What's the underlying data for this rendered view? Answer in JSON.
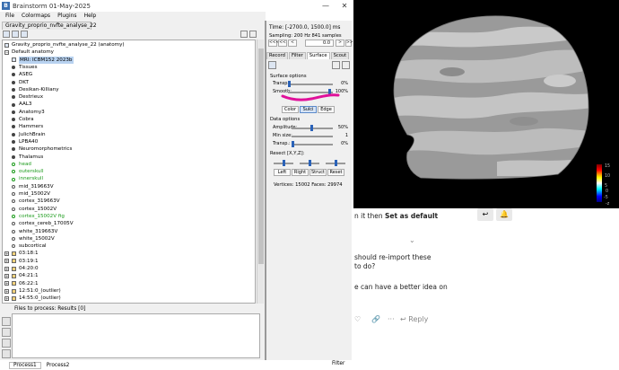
{
  "window": {
    "title": "Brainstorm 01-May-2025",
    "logo": "B",
    "minimize": "—",
    "close": "✕"
  },
  "menu": [
    "File",
    "Colormaps",
    "Plugins",
    "Help"
  ],
  "protocol_tab": "Gravity_proprio_nvfte_analyse_22",
  "tree": {
    "subject": "Gravity_proprio_nvfte_analyse_22 (anatomy)",
    "default_anatomy": "Default anatomy",
    "items": [
      {
        "label": "MRI: ICBM152 2023b",
        "kind": "mri",
        "selected": true
      },
      {
        "label": "Tissues",
        "kind": "dot"
      },
      {
        "label": "ASEG",
        "kind": "dot"
      },
      {
        "label": "DKT",
        "kind": "dot"
      },
      {
        "label": "Desikan-Killiany",
        "kind": "dot"
      },
      {
        "label": "Destrieux",
        "kind": "dot"
      },
      {
        "label": "AAL3",
        "kind": "dot"
      },
      {
        "label": "Anatomy3",
        "kind": "dot"
      },
      {
        "label": "Cobra",
        "kind": "dot"
      },
      {
        "label": "Hammers",
        "kind": "dot"
      },
      {
        "label": "JulichBrain",
        "kind": "dot"
      },
      {
        "label": "LPBA40",
        "kind": "dot"
      },
      {
        "label": "Neuromorphometrics",
        "kind": "dot"
      },
      {
        "label": "Thalamus",
        "kind": "dot"
      },
      {
        "label": "head",
        "kind": "surf",
        "green": true
      },
      {
        "label": "outerskull",
        "kind": "surf",
        "green": true
      },
      {
        "label": "innerskull",
        "kind": "surf",
        "green": true
      },
      {
        "label": "mid_319663V",
        "kind": "surf"
      },
      {
        "label": "mid_15002V",
        "kind": "surf"
      },
      {
        "label": "cortex_319663V",
        "kind": "surf"
      },
      {
        "label": "cortex_15002V",
        "kind": "surf"
      },
      {
        "label": "cortex_15002V fig",
        "kind": "surf",
        "green": true
      },
      {
        "label": "cortex_cereb_17005V",
        "kind": "surf"
      },
      {
        "label": "white_319663V",
        "kind": "surf"
      },
      {
        "label": "white_15002V",
        "kind": "surf"
      },
      {
        "label": "subcortical",
        "kind": "surf"
      }
    ],
    "folders": [
      "03:18:1",
      "03:19:1",
      "04:20:0",
      "04:21:1",
      "06:22:1",
      "12:51:0_(outlier)",
      "14:55:0_(outlier)"
    ]
  },
  "files": {
    "label": "Files to process: Results [0]"
  },
  "bottom": {
    "tabs": [
      "Process1",
      "Process2"
    ],
    "filter": "Filter"
  },
  "panel": {
    "time": "Time:  [-2700.0, 1500.0] ms",
    "sampling": "Sampling: 200 Hz    841 samples",
    "nav": [
      "<<<",
      "<<",
      "<",
      "",
      ">",
      ">>"
    ],
    "nav_value": "0.0",
    "tabs": [
      "Record",
      "Filter",
      "Surface",
      "Scout"
    ],
    "surface_options_title": "Surface options",
    "transp_label": "Transp.:",
    "transp_value": "0%",
    "smooth_label": "Smooth:",
    "smooth_value": "100%",
    "view_buttons": [
      "Color",
      "Sulci",
      "Edge"
    ],
    "data_options_title": "Data options",
    "amplitude_label": "Amplitude:",
    "amplitude_value": "50%",
    "minsize_label": "Min size:",
    "minsize_value": "1",
    "dtransp_label": "Transp.:",
    "dtransp_value": "0%",
    "resect_title": "Resect [X,Y,Z]:",
    "resect_buttons": [
      "Left",
      "Right",
      "Struct",
      "Reset"
    ],
    "vertices": "Vertices: 15002    Faces: 29974"
  },
  "colorbar": {
    "ticks": [
      "15",
      "10",
      "5",
      "0",
      "-5",
      "-z"
    ],
    "accent": "#2a62b8",
    "annotation_color": "#e0119a"
  },
  "forum": {
    "line1": "n it then ",
    "line1_bold": "Set as default",
    "line2": "should re-import these",
    "line3": "to do?",
    "line4": "e can have a better idea on",
    "reply": "Reply",
    "chevron": "⌄"
  }
}
